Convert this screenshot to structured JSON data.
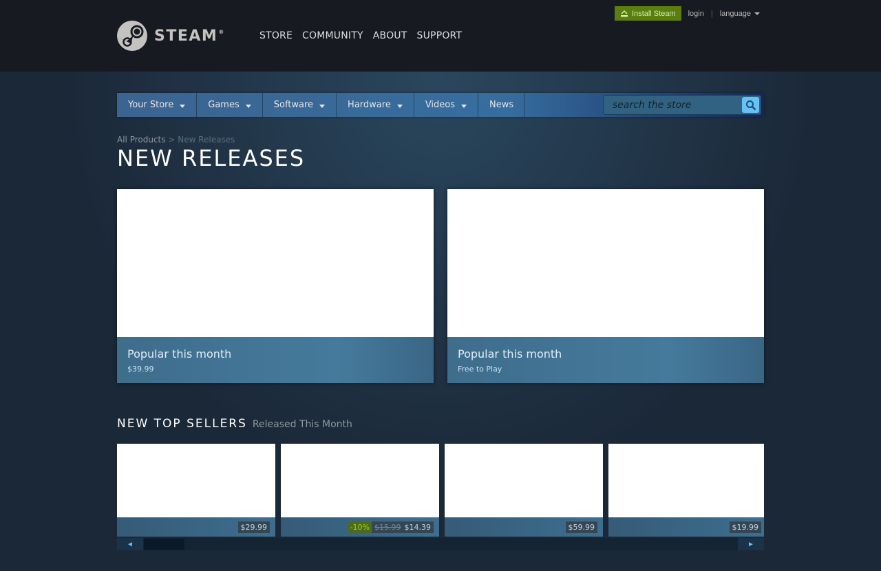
{
  "header": {
    "logo_text": "STEAM",
    "logo_mark": "®",
    "nav": [
      "STORE",
      "COMMUNITY",
      "ABOUT",
      "SUPPORT"
    ],
    "install_label": "Install Steam",
    "login_label": "login",
    "separator": "|",
    "language_label": "language"
  },
  "store_nav": {
    "tabs": [
      {
        "label": "Your Store",
        "dropdown": true
      },
      {
        "label": "Games",
        "dropdown": true
      },
      {
        "label": "Software",
        "dropdown": true
      },
      {
        "label": "Hardware",
        "dropdown": true
      },
      {
        "label": "Videos",
        "dropdown": true
      },
      {
        "label": "News",
        "dropdown": false
      }
    ],
    "search_placeholder": "search the store"
  },
  "breadcrumb": {
    "root": "All Products",
    "sep": ">",
    "current": "New Releases"
  },
  "page_title": "NEW RELEASES",
  "featured": [
    {
      "title": "Popular this month",
      "price": "$39.99"
    },
    {
      "title": "Popular this month",
      "price": "Free to Play"
    }
  ],
  "top_sellers": {
    "heading": "NEW TOP SELLERS",
    "subheading": "Released This Month",
    "items": [
      {
        "price": "$29.99"
      },
      {
        "discount": "-10%",
        "original": "$15.99",
        "price": "$14.39"
      },
      {
        "price": "$59.99"
      },
      {
        "price": "$19.99"
      }
    ]
  },
  "scroll": {
    "left": "◄",
    "right": "►"
  },
  "colors": {
    "header_bg": "#171a21",
    "page_bg": "#1b2838",
    "install_green": "#5c7e10",
    "accent_blue": "#67c1f5",
    "discount_green": "#a4d007"
  },
  "icons": [
    "steam-logo-icon",
    "download-icon",
    "caret-down-icon",
    "search-icon"
  ]
}
